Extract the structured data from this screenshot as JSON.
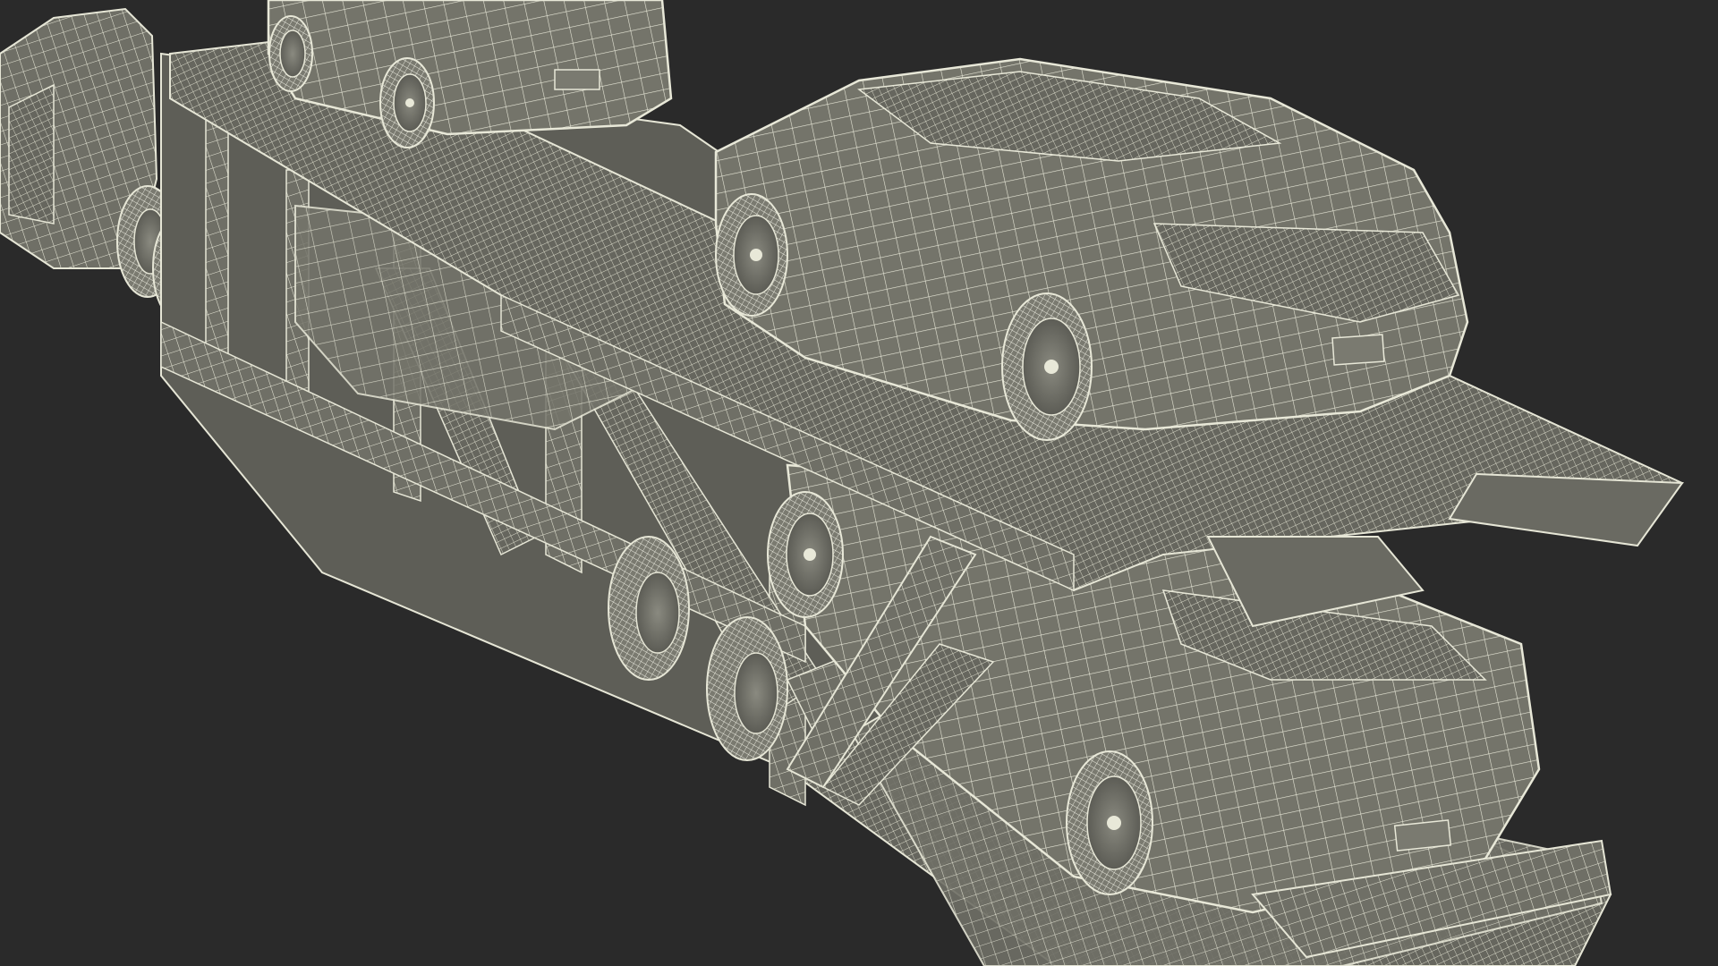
{
  "scene": {
    "background_color": "#2a2a2a",
    "wire_color": "#e6e6d6",
    "panel_color": "#6f6f66",
    "panel_dark_color": "#585852",
    "objects": [
      "car-carrier-truck",
      "trailer-frame",
      "upper-deck-sedan-front",
      "upper-deck-sedan-rear",
      "lower-deck-sedan-front",
      "lower-deck-sedan-rear"
    ]
  }
}
